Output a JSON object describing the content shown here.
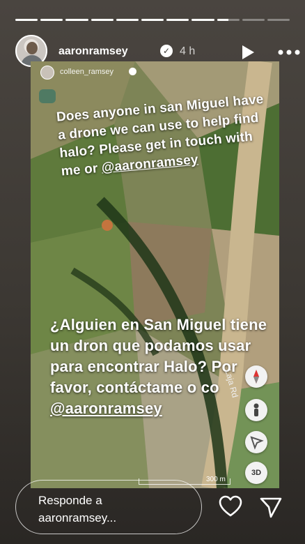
{
  "story": {
    "progress_segments": [
      1,
      1,
      1,
      1,
      1,
      1,
      1,
      1,
      0.5,
      0,
      0
    ]
  },
  "header": {
    "username": "aaronramsey",
    "verified_icon": "verified-badge",
    "time": "4 h",
    "play_icon": "play",
    "more_icon": "ellipsis"
  },
  "repost": {
    "username": "colleen_ramsey"
  },
  "captions": {
    "english_text": "Does anyone in san Miguel have a drone we can use to help find halo? Please get in touch with me or ",
    "english_mention": "@aaronramsey",
    "spanish_text": "¿Alguien en San Miguel tiene un dron que podamos usar para encontrar Halo? Por favor, contáctame o co",
    "spanish_mention": "@aaronramsey"
  },
  "map": {
    "road_label": "Laja Rd",
    "scale_label": "300 m",
    "controls": [
      "compass",
      "pegman",
      "location",
      "3D"
    ],
    "btn_3d": "3D"
  },
  "reply": {
    "placeholder": "Responde a aaronramsey..."
  },
  "icons": {
    "like": "heart-outline",
    "share": "paper-plane"
  }
}
